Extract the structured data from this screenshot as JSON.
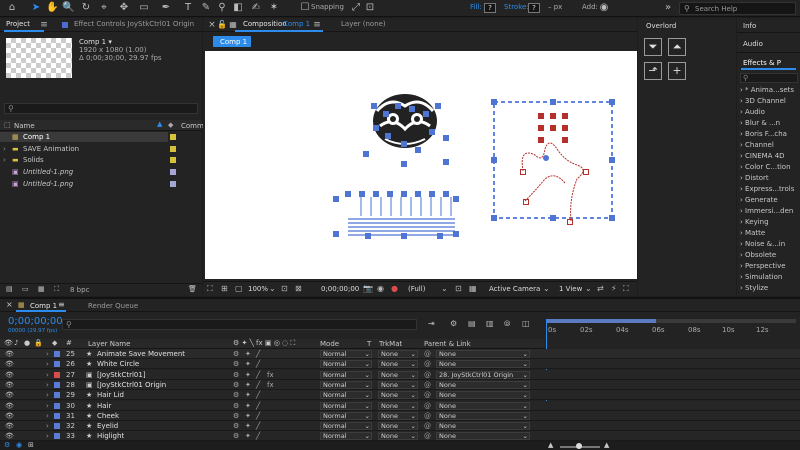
{
  "toolbar": {
    "snapping_label": "Snapping",
    "fill_label": "Fill:",
    "stroke_label": "Stroke:",
    "stroke_value": "–  px",
    "add_label": "Add:",
    "search_placeholder": "Search Help",
    "fill_value": "?",
    "stroke_box_value": "?"
  },
  "project_panel": {
    "tab_project": "Project",
    "tab_effect_controls": "Effect Controls JoyStkCtrl01 Origin",
    "thumb_title": "Comp 1 ▾",
    "thumb_size": "1920 x 1080 (1.00)",
    "thumb_duration": "Δ 0;00;30;00, 29.97 fps",
    "col_name": "Name",
    "col_comment": "Comm",
    "items": [
      {
        "label": "Comp 1"
      },
      {
        "label": "SAVE Animation"
      },
      {
        "label": "Solids"
      },
      {
        "label": "Untitled-1.png"
      },
      {
        "label": "Untitled-1.png"
      }
    ],
    "bpc": "8 bpc"
  },
  "composition_panel": {
    "tab_composition": "Composition",
    "tab_comp_name": "Comp 1",
    "tab_layer": "Layer (none)",
    "subtab": "Comp 1",
    "zoom": "100%",
    "timecode": "0;00;00;00",
    "resolution": "(Full)",
    "camera": "Active Camera",
    "views": "1 View"
  },
  "overlord_panel": {
    "title": "Overlord"
  },
  "right_panel": {
    "info": "Info",
    "audio": "Audio",
    "effects_title": "Effects & P",
    "effects": [
      "* Anima...sets",
      "3D Channel",
      "Audio",
      "Blur & ...n",
      "Boris F...cha",
      "Channel",
      "CINEMA 4D",
      "Color C...tion",
      "Distort",
      "Express...trols",
      "Generate",
      "Immersi...den",
      "Keying",
      "Matte",
      "Noise &...in",
      "Obsolete",
      "Perspective",
      "Simulation",
      "Stylize"
    ]
  },
  "timeline": {
    "tab_comp": "Comp 1",
    "tab_render": "Render Queue",
    "timecode": "0;00;00;00",
    "frame_info": "00000 (29.97 fps)",
    "col_layer_name": "Layer Name",
    "col_mode": "Mode",
    "col_t": "T",
    "col_trkmat": "TrkMat",
    "col_parent": "Parent & Link",
    "ruler": [
      "0s",
      "02s",
      "04s",
      "06s",
      "08s",
      "10s",
      "12s"
    ],
    "layers": [
      {
        "num": "25",
        "name": "Animate Save Movement",
        "mode": "Normal",
        "trkmat": "None",
        "parent": "None",
        "color": "#5a7bd6"
      },
      {
        "num": "26",
        "name": "White Circle",
        "mode": "Normal",
        "trkmat": "None",
        "parent": "None",
        "color": "#5a7bd6"
      },
      {
        "num": "27",
        "name": "[JoyStkCtrl01]",
        "mode": "Normal",
        "trkmat": "None",
        "parent": "28. JoyStkCtrl01 Origin",
        "color": "#b6302a"
      },
      {
        "num": "28",
        "name": "[JoyStkCtrl01 Origin",
        "mode": "Normal",
        "trkmat": "None",
        "parent": "None",
        "color": "#5a7bd6"
      },
      {
        "num": "29",
        "name": "Hair Lid",
        "mode": "Normal",
        "trkmat": "None",
        "parent": "None",
        "color": "#5a7bd6"
      },
      {
        "num": "30",
        "name": "Hair",
        "mode": "Normal",
        "trkmat": "None",
        "parent": "None",
        "color": "#5a7bd6"
      },
      {
        "num": "31",
        "name": "Cheek",
        "mode": "Normal",
        "trkmat": "None",
        "parent": "None",
        "color": "#5a7bd6"
      },
      {
        "num": "32",
        "name": "Eyelid",
        "mode": "Normal",
        "trkmat": "None",
        "parent": "None",
        "color": "#5a7bd6"
      },
      {
        "num": "33",
        "name": "Higlight",
        "mode": "Normal",
        "trkmat": "None",
        "parent": "None",
        "color": "#5a7bd6"
      }
    ]
  },
  "colors": {
    "accent": "#2d8ceb",
    "layer_blue": "#4b6ec0",
    "layer_red": "#b6302a",
    "label_yellow": "#d6c23a"
  }
}
